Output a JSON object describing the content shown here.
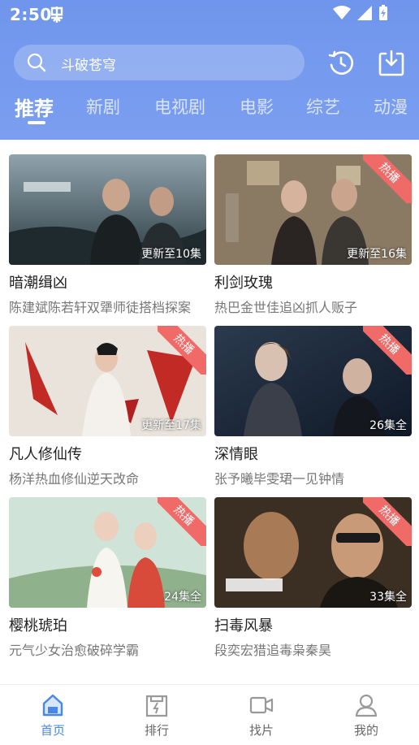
{
  "status": {
    "time": "2:50"
  },
  "search": {
    "placeholder": "斗破苍穹"
  },
  "tabs": [
    "推荐",
    "新剧",
    "电视剧",
    "电影",
    "综艺",
    "动漫"
  ],
  "hot_label": "热播",
  "cards": [
    {
      "title": "暗潮缉凶",
      "subtitle": "陈建斌陈若轩双犟师徒搭档探案",
      "episode": "更新至10集",
      "hot": false
    },
    {
      "title": "利剑玫瑰",
      "subtitle": "热巴金世佳追凶抓人贩子",
      "episode": "更新至16集",
      "hot": true
    },
    {
      "title": "凡人修仙传",
      "subtitle": "杨洋热血修仙逆天改命",
      "episode": "更新至17集",
      "hot": true
    },
    {
      "title": "深情眼",
      "subtitle": "张予曦毕雯珺一见钟情",
      "episode": "26集全",
      "hot": true
    },
    {
      "title": "樱桃琥珀",
      "subtitle": "元气少女治愈破碎学霸",
      "episode": "24集全",
      "hot": true
    },
    {
      "title": "扫毒风暴",
      "subtitle": "段奕宏猎追毒枭秦昊",
      "episode": "33集全",
      "hot": true
    }
  ],
  "nav": [
    {
      "label": "首页",
      "icon": "home-icon",
      "active": true
    },
    {
      "label": "排行",
      "icon": "ranking-icon",
      "active": false
    },
    {
      "label": "找片",
      "icon": "video-camera-icon",
      "active": false
    },
    {
      "label": "我的",
      "icon": "user-icon",
      "active": false
    }
  ],
  "colors": {
    "header": "#7b9ef0",
    "accent": "#4a86e8",
    "hot": "#f06a68"
  }
}
